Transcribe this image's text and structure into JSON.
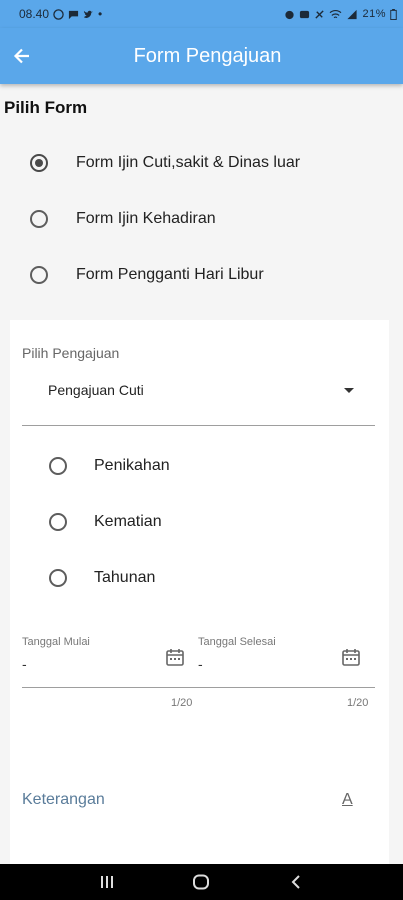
{
  "status": {
    "time": "08.40",
    "battery": "21%"
  },
  "header": {
    "title": "Form Pengajuan"
  },
  "form_select": {
    "title": "Pilih Form",
    "options": [
      {
        "label": "Form Ijin Cuti,sakit & Dinas luar",
        "checked": true
      },
      {
        "label": "Form Ijin Kehadiran",
        "checked": false
      },
      {
        "label": "Form Pengganti Hari Libur",
        "checked": false
      }
    ]
  },
  "pengajuan": {
    "caption": "Pilih Pengajuan",
    "value": "Pengajuan Cuti",
    "types": [
      {
        "label": "Penikahan",
        "checked": false
      },
      {
        "label": "Kematian",
        "checked": false
      },
      {
        "label": "Tahunan",
        "checked": false
      }
    ]
  },
  "dates": {
    "start_label": "Tanggal Mulai",
    "start_value": "-",
    "start_counter": "1/20",
    "end_label": "Tanggal Selesai",
    "end_value": "-",
    "end_counter": "1/20"
  },
  "keterangan": {
    "label": "Keterangan",
    "icon_glyph": "A"
  }
}
